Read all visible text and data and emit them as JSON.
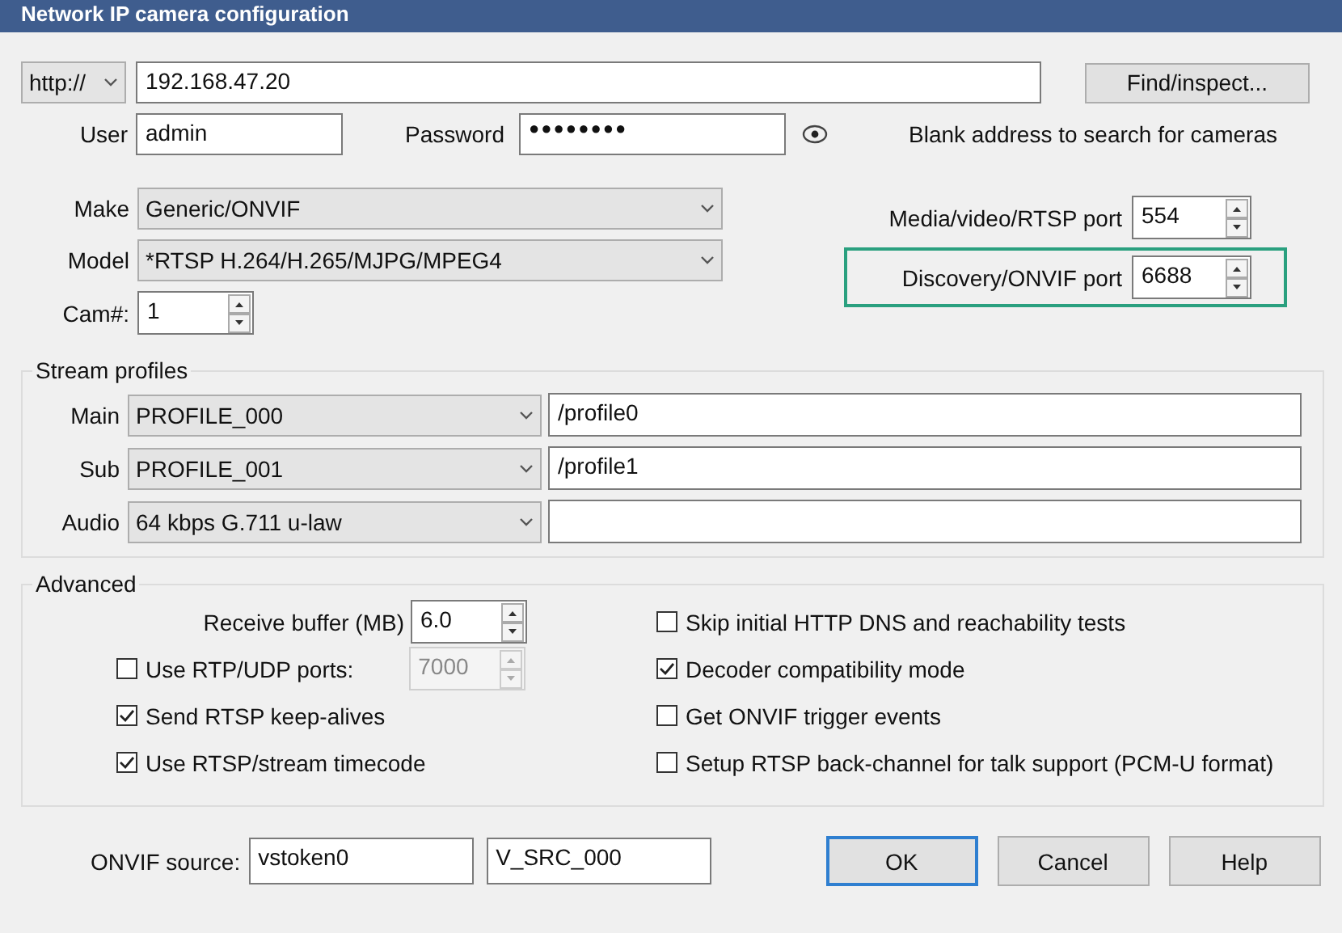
{
  "window": {
    "title": "Network IP camera configuration"
  },
  "address": {
    "protocol": "http://",
    "value": "192.168.47.20"
  },
  "find_button": "Find/inspect...",
  "user": {
    "label": "User",
    "value": "admin"
  },
  "password": {
    "label": "Password",
    "value": "●●●●●●●●"
  },
  "hint": "Blank address to search for cameras",
  "make": {
    "label": "Make",
    "value": "Generic/ONVIF"
  },
  "model": {
    "label": "Model",
    "value": "*RTSP H.264/H.265/MJPG/MPEG4"
  },
  "cam": {
    "label": "Cam#:",
    "value": "1"
  },
  "ports": [
    {
      "label": "Media/video/RTSP port",
      "value": "554",
      "highlighted": false
    },
    {
      "label": "Discovery/ONVIF port",
      "value": "6688",
      "highlighted": true
    }
  ],
  "stream_profiles": {
    "title": "Stream profiles",
    "rows": [
      {
        "label": "Main",
        "profile": "PROFILE_000",
        "path": "/profile0"
      },
      {
        "label": "Sub",
        "profile": "PROFILE_001",
        "path": "/profile1"
      },
      {
        "label": "Audio",
        "profile": "64 kbps G.711 u-law"
      }
    ]
  },
  "advanced": {
    "title": "Advanced",
    "receive_buffer": {
      "label": "Receive buffer (MB)",
      "value": "6.0"
    },
    "left_options": [
      {
        "label": "Use RTP/UDP ports:",
        "checked": false,
        "port": {
          "value": "7000",
          "disabled": true
        }
      },
      {
        "label": "Send RTSP keep-alives",
        "checked": true
      },
      {
        "label": "Use RTSP/stream timecode",
        "checked": true
      }
    ],
    "right_options": [
      {
        "label": "Skip initial HTTP DNS and reachability tests",
        "checked": false
      },
      {
        "label": "Decoder compatibility mode",
        "checked": true
      },
      {
        "label": "Get ONVIF trigger events",
        "checked": false
      },
      {
        "label": "Setup RTSP back-channel for talk support (PCM-U format)",
        "checked": false
      }
    ]
  },
  "onvif_source": {
    "label": "ONVIF source:",
    "values": [
      "vstoken0",
      "V_SRC_000"
    ]
  },
  "buttons": [
    {
      "label": "OK",
      "default": true
    },
    {
      "label": "Cancel",
      "default": false
    },
    {
      "label": "Help",
      "default": false
    }
  ]
}
